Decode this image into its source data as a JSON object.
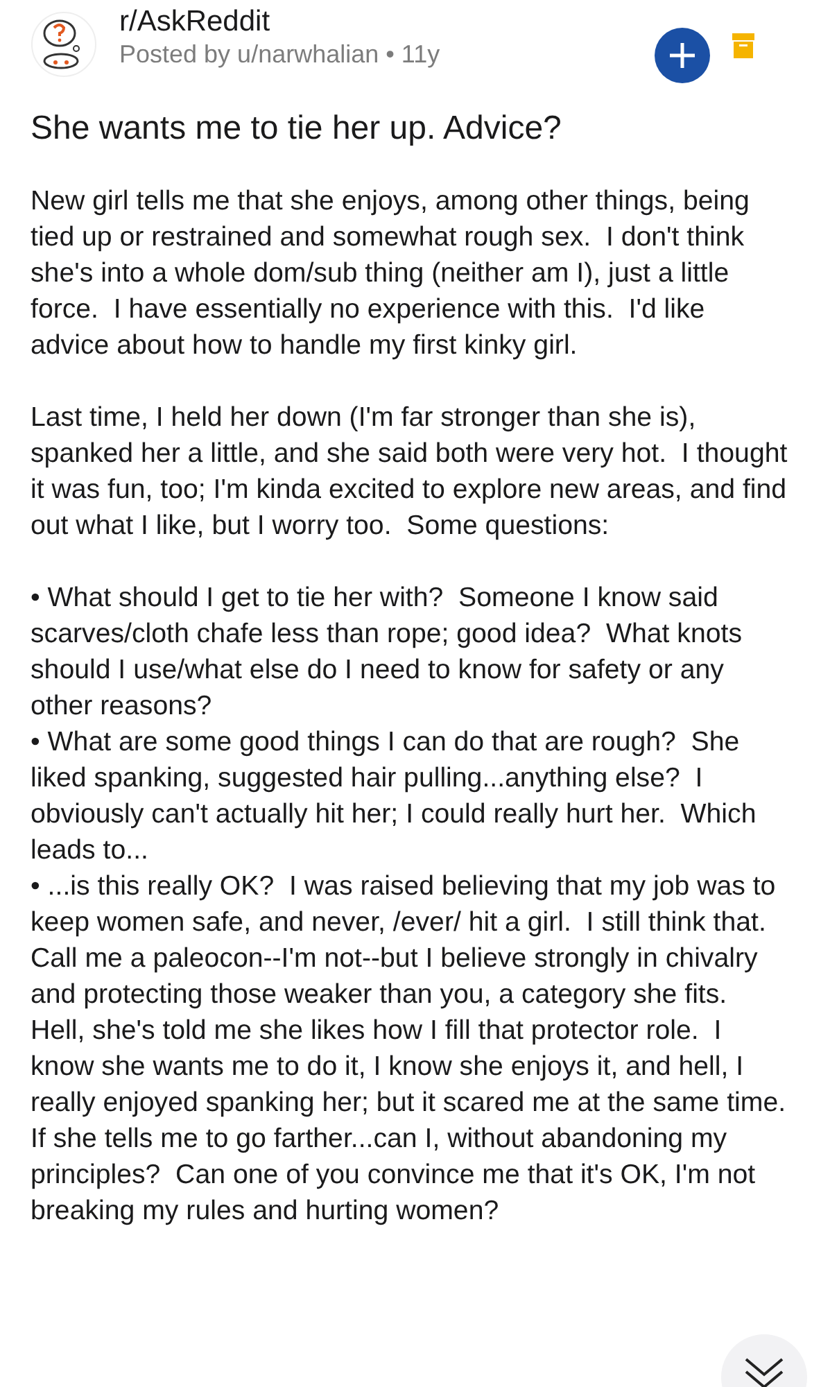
{
  "post": {
    "subreddit": "r/AskReddit",
    "byline": "Posted by u/narwhalian • 11y",
    "title": "She wants me to tie her up.  Advice?",
    "body": [
      {
        "kind": "paragraph",
        "text": "New girl tells me that she enjoys, among other things, being tied up or restrained and somewhat rough sex.  I don't think she's into a whole dom/sub thing (neither am I), just a little force.  I have essentially no experience with this.  I'd like advice about how to handle my first kinky girl."
      },
      {
        "kind": "paragraph",
        "text": "Last time, I held her down (I'm far stronger than she is), spanked her a little, and she said both were very hot.  I thought it was fun, too; I'm kinda excited to explore new areas, and find out what I like, but I worry too.  Some questions:"
      },
      {
        "kind": "paragraph",
        "text": "• What should I get to tie her with?  Someone I know said scarves/cloth chafe less than rope; good idea?  What knots should I use/what else do I need to know for safety or any other reasons?"
      },
      {
        "kind": "line",
        "text": "• What are some good things I can do that are rough?  She liked spanking, suggested hair pulling...anything else?  I obviously can't actually hit her; I could really hurt her.  Which leads to..."
      },
      {
        "kind": "line",
        "text": "• ...is this really OK?  I was raised believing that my job was to keep women safe, and never, /ever/ hit a girl.  I still think that.  Call me a paleocon--I'm not--but I believe strongly in chivalry and protecting those weaker than you, a category she fits.  Hell, she's told me she likes how I fill that protector role.  I know she wants me to do it, I know she enjoys it, and hell, I really enjoyed spanking her; but it scared me at the same time.  If she tells me to go farther...can I, without abandoning my principles?  Can one of you convince me that it's OK, I'm not breaking my rules and hurting women?"
      }
    ]
  }
}
